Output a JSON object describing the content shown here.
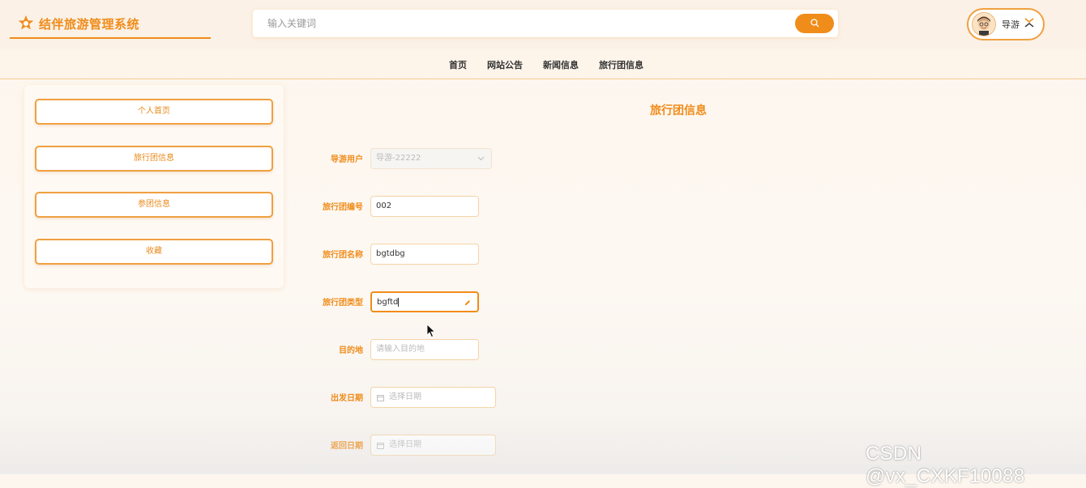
{
  "header": {
    "app_title": "结伴旅游管理系统",
    "search_placeholder": "输入关键词",
    "user_name": "导游"
  },
  "nav": {
    "items": [
      "首页",
      "网站公告",
      "新闻信息",
      "旅行团信息"
    ]
  },
  "sidebar": {
    "items": [
      "个人首页",
      "旅行团信息",
      "参团信息",
      "收藏"
    ]
  },
  "form": {
    "title": "旅行团信息",
    "fields": {
      "guide_user": {
        "label": "导游用户",
        "value": "导游-22222"
      },
      "group_no": {
        "label": "旅行团编号",
        "value": "002"
      },
      "group_name": {
        "label": "旅行团名称",
        "value": "bgtdbg"
      },
      "group_type": {
        "label": "旅行团类型",
        "value": "bgftd"
      },
      "destination": {
        "label": "目的地",
        "placeholder": "请输入目的地"
      },
      "depart_date": {
        "label": "出发日期",
        "placeholder": "选择日期"
      },
      "return_date": {
        "label": "返回日期",
        "placeholder": "选择日期"
      }
    }
  },
  "watermark": "CSDN @vx_CXKF10088",
  "colors": {
    "accent": "#f08c1a",
    "border": "#f0a040"
  }
}
